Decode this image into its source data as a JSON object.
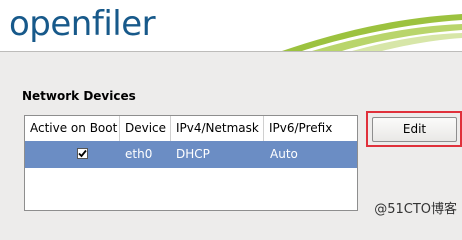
{
  "header": {
    "logo_text": "openfiler"
  },
  "section": {
    "title": "Network Devices"
  },
  "table": {
    "columns": [
      "Active on Boot",
      "Device",
      "IPv4/Netmask",
      "IPv6/Prefix"
    ],
    "rows": [
      {
        "active_on_boot": true,
        "device": "eth0",
        "ipv4": "DHCP",
        "ipv6": "Auto"
      }
    ]
  },
  "buttons": {
    "edit_label": "Edit"
  },
  "watermark": "@51CTO博客",
  "colors": {
    "selection": "#6b8dc4",
    "highlight": "#e0313b",
    "logo": "#17598a"
  }
}
